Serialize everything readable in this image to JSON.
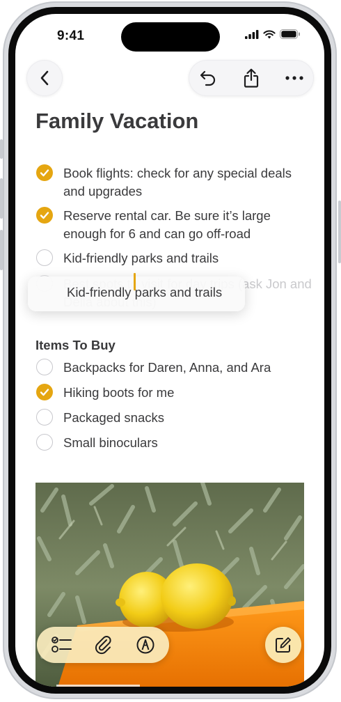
{
  "status": {
    "time": "9:41"
  },
  "icons": {
    "back": "chevron-left-icon",
    "undo": "undo-icon",
    "share": "share-icon",
    "more": "ellipsis-icon",
    "checklist": "checklist-icon",
    "attach": "paperclip-icon",
    "markup": "pen-circle-icon",
    "compose": "compose-icon"
  },
  "colors": {
    "accent": "#e5a611",
    "text": "#3a3a3c",
    "unchecked": "#c7c7cc"
  },
  "note": {
    "title": "Family Vacation",
    "checklist": [
      {
        "text": "Book flights: check for any special deals and upgrades",
        "checked": true
      },
      {
        "text": "Reserve rental car. Be sure it’s large enough for 6 and can go off-road",
        "checked": true
      },
      {
        "text": "Kid-friendly parks and trails",
        "checked": false
      }
    ],
    "ghost_item": {
      "text": "Best spots to visit for day trips (ask Jon and Della about this)",
      "checked": false
    },
    "dragging_item": {
      "text": "Kid-friendly parks and trails"
    },
    "section_title": "Items To Buy",
    "buy_list": [
      {
        "text": "Backpacks for Daren, Anna, and Ara",
        "checked": false
      },
      {
        "text": "Hiking boots for me",
        "checked": true
      },
      {
        "text": "Packaged snacks",
        "checked": false
      },
      {
        "text": "Small binoculars",
        "checked": false
      }
    ],
    "photo": "lemons-on-orange-table-image"
  }
}
